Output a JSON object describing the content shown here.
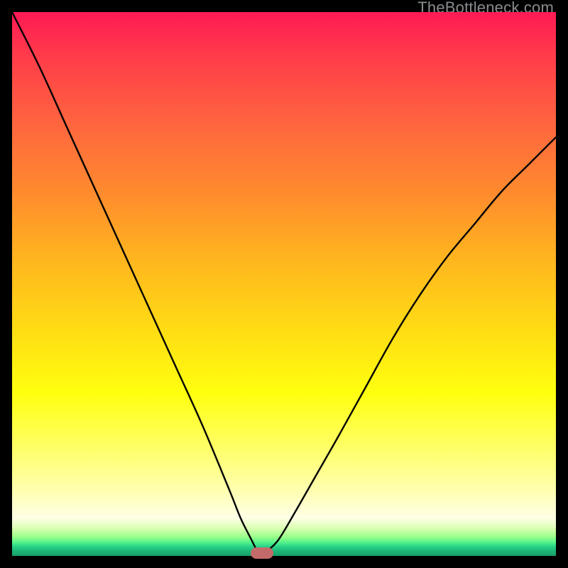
{
  "watermark": "TheBottleneck.com",
  "chart_data": {
    "type": "line",
    "title": "",
    "xlabel": "",
    "ylabel": "",
    "xlim": [
      0,
      100
    ],
    "ylim": [
      0,
      100
    ],
    "grid": false,
    "legend": false,
    "background": {
      "gradient_stops": [
        {
          "pos": 0,
          "color": "#ff1a55"
        },
        {
          "pos": 22,
          "color": "#ff6a3d"
        },
        {
          "pos": 45,
          "color": "#ffb41f"
        },
        {
          "pos": 70,
          "color": "#ffff0f"
        },
        {
          "pos": 93,
          "color": "#ffffe6"
        },
        {
          "pos": 100,
          "color": "#169e68"
        }
      ]
    },
    "series": [
      {
        "name": "left-branch",
        "color": "#000000",
        "x": [
          0,
          5,
          10,
          15,
          20,
          25,
          30,
          35,
          40,
          42,
          44,
          45
        ],
        "y": [
          100,
          90,
          79,
          68,
          57,
          46,
          35,
          24,
          12,
          7,
          3,
          1
        ]
      },
      {
        "name": "right-branch",
        "color": "#000000",
        "x": [
          47,
          49,
          52,
          56,
          60,
          65,
          70,
          75,
          80,
          85,
          90,
          95,
          100
        ],
        "y": [
          1,
          3,
          8,
          15,
          22,
          31,
          40,
          48,
          55,
          61,
          67,
          72,
          77
        ]
      }
    ],
    "marker": {
      "name": "minimum-marker",
      "x": 46,
      "y": 0.5,
      "color": "#c46a6a",
      "shape": "rounded-rect"
    }
  },
  "colors": {
    "frame": "#000000",
    "curve": "#000000",
    "marker": "#c46a6a"
  }
}
